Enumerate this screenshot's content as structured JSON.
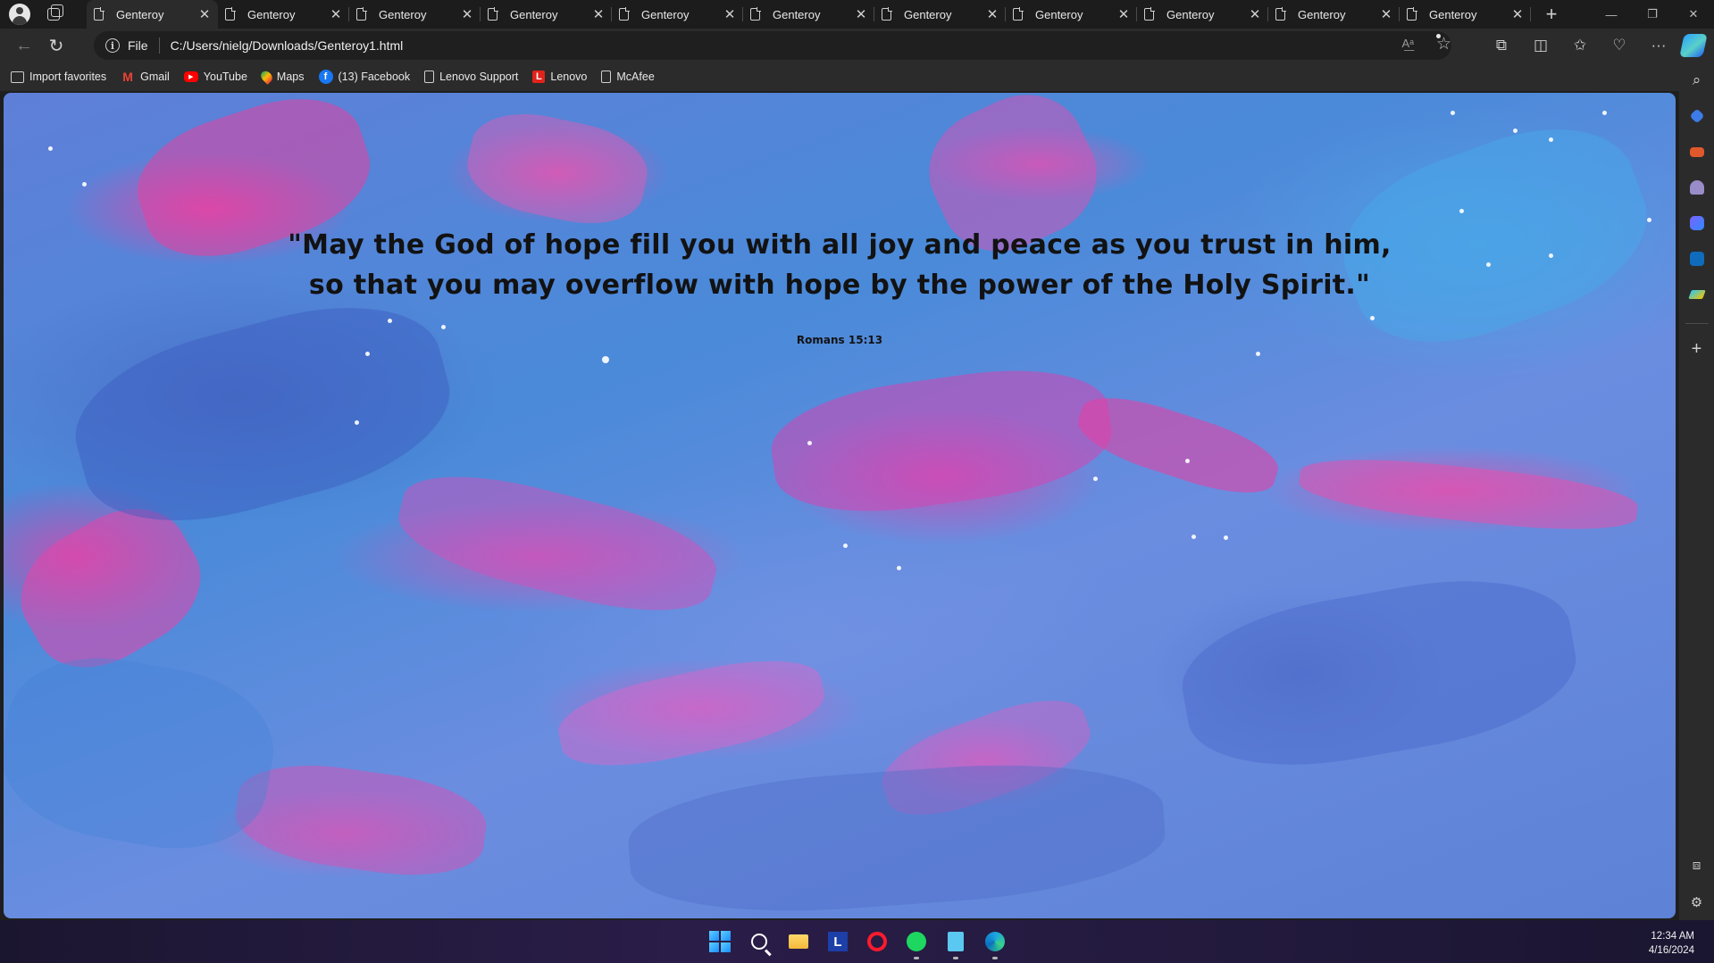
{
  "browser": {
    "tabs": [
      {
        "title": "Genteroy",
        "active": true
      },
      {
        "title": "Genteroy",
        "active": false
      },
      {
        "title": "Genteroy",
        "active": false
      },
      {
        "title": "Genteroy",
        "active": false
      },
      {
        "title": "Genteroy",
        "active": false
      },
      {
        "title": "Genteroy",
        "active": false
      },
      {
        "title": "Genteroy",
        "active": false
      },
      {
        "title": "Genteroy",
        "active": false
      },
      {
        "title": "Genteroy",
        "active": false
      },
      {
        "title": "Genteroy",
        "active": false
      },
      {
        "title": "Genteroy",
        "active": false
      }
    ],
    "address": {
      "scheme_label": "File",
      "url": "C:/Users/nielg/Downloads/Genteroy1.html"
    },
    "favorites": [
      {
        "label": "Import favorites",
        "icon": "import-icon"
      },
      {
        "label": "Gmail",
        "icon": "gmail-icon"
      },
      {
        "label": "YouTube",
        "icon": "youtube-icon"
      },
      {
        "label": "Maps",
        "icon": "maps-icon"
      },
      {
        "label": "(13) Facebook",
        "icon": "facebook-icon"
      },
      {
        "label": "Lenovo Support",
        "icon": "page-icon"
      },
      {
        "label": "Lenovo",
        "icon": "lenovo-icon"
      },
      {
        "label": "McAfee",
        "icon": "page-icon"
      }
    ]
  },
  "page": {
    "quote_line1": "\"May the God of hope fill you with all joy and peace as you trust in him,",
    "quote_line2": "so that you may overflow with hope by the power of the Holy Spirit.\"",
    "reference": "Romans 15:13"
  },
  "taskbar": {
    "time": "12:34 AM",
    "date": "4/16/2024"
  },
  "colors": {
    "browser_bg": "#2b2b2b",
    "tabstrip_bg": "#1c1c1c",
    "quote_text": "#121212",
    "accent_pink": "#e046aa",
    "accent_blue": "#4a8ad9"
  }
}
